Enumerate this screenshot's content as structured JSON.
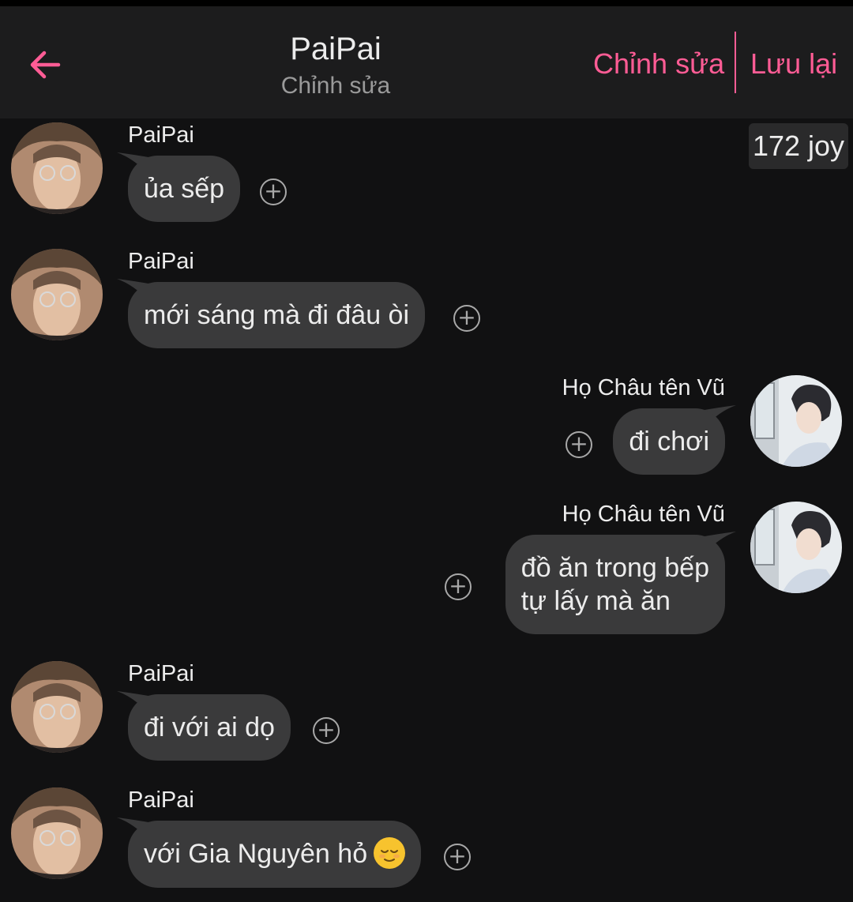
{
  "header": {
    "title": "PaiPai",
    "subtitle": "Chỉnh sửa",
    "edit_label": "Chỉnh sửa",
    "save_label": "Lưu lại",
    "accent": "#ff5c95"
  },
  "badge": {
    "text": "172 joy"
  },
  "messages": [
    {
      "side": "left",
      "sender": "PaiPai",
      "text": "ủa sếp"
    },
    {
      "side": "left",
      "sender": "PaiPai",
      "text": "mới sáng mà đi đâu òi"
    },
    {
      "side": "right",
      "sender": "Họ Châu tên Vũ",
      "text": "đi chơi"
    },
    {
      "side": "right",
      "sender": "Họ Châu tên Vũ",
      "lines": [
        "đồ ăn trong bếp",
        "tự lấy mà ăn"
      ]
    },
    {
      "side": "left",
      "sender": "PaiPai",
      "text": "đi với ai dọ"
    },
    {
      "side": "left",
      "sender": "PaiPai",
      "text": "với Gia Nguyên hỏ",
      "emoji": "relieved-face"
    }
  ],
  "icons": {
    "back": "arrow-left-icon",
    "add": "plus-circle-icon"
  }
}
